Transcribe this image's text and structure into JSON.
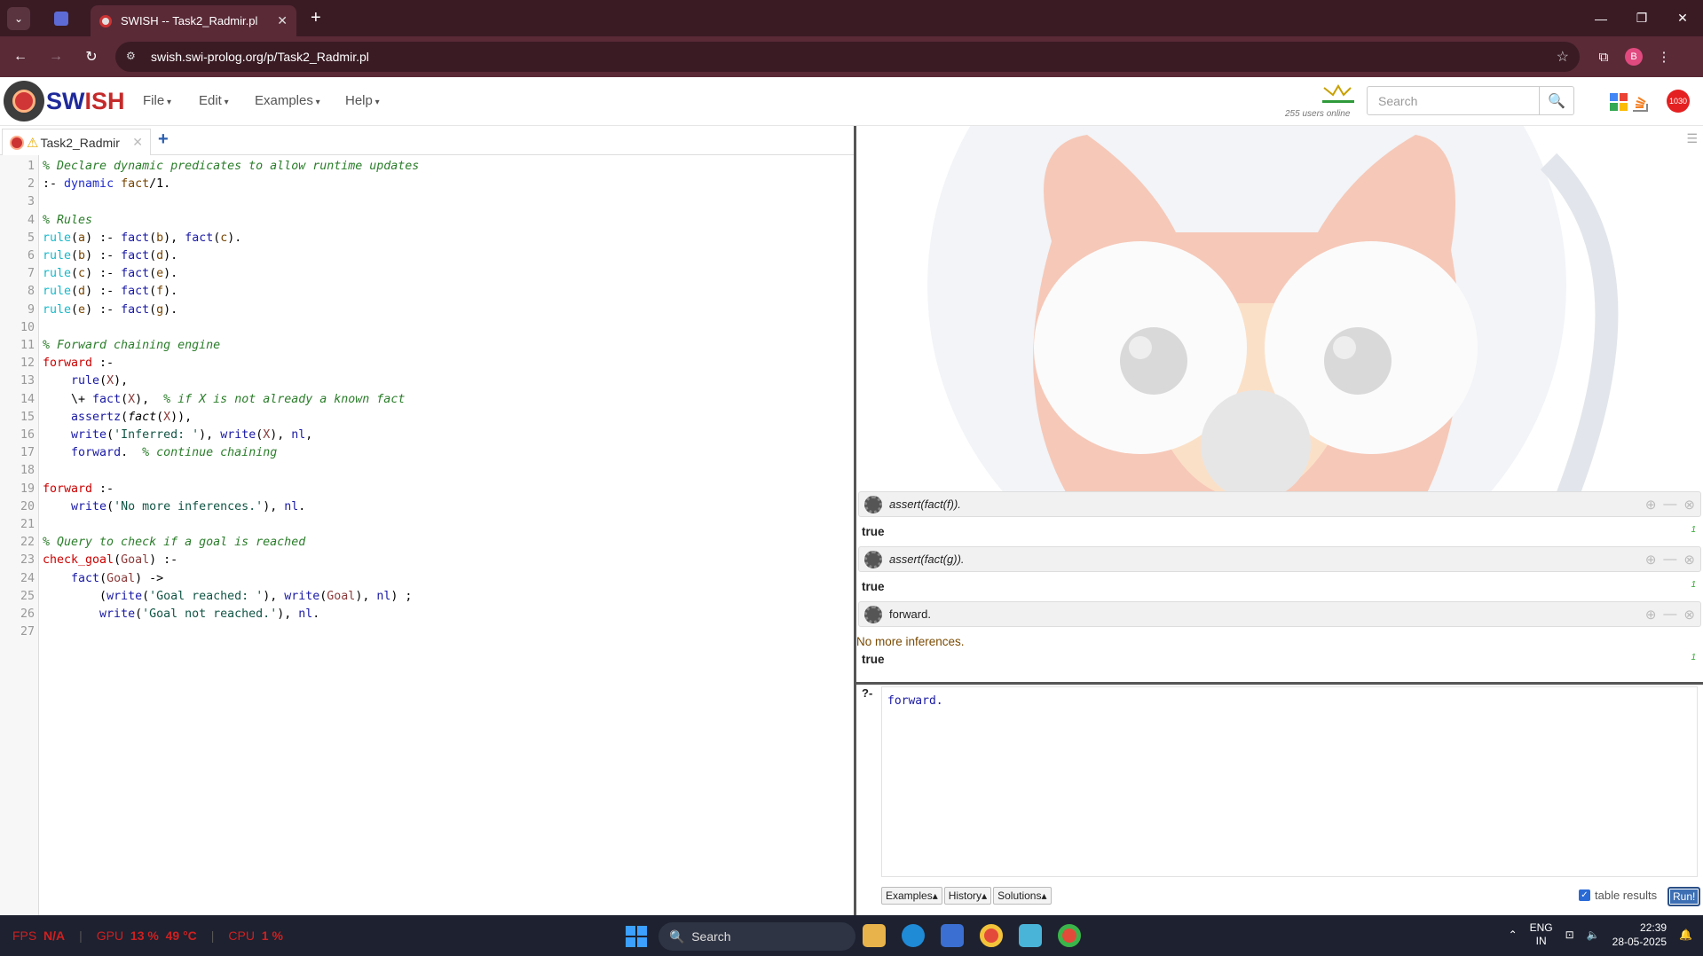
{
  "browser": {
    "tab_title": "SWISH -- Task2_Radmir.pl",
    "url": "swish.swi-prolog.org/p/Task2_Radmir.pl",
    "profile_initial": "B"
  },
  "swish": {
    "brand_prefix": "SW",
    "brand_suffix": "ISH",
    "menus": [
      "File",
      "Edit",
      "Examples",
      "Help"
    ],
    "users_online": "255 users online",
    "search_placeholder": "Search",
    "notif_count": "1030"
  },
  "editor": {
    "tab_label": "Task2_Radmir",
    "lines": [
      {
        "n": "1"
      },
      {
        "n": "2"
      },
      {
        "n": "3"
      },
      {
        "n": "4"
      },
      {
        "n": "5"
      },
      {
        "n": "6"
      },
      {
        "n": "7"
      },
      {
        "n": "8"
      },
      {
        "n": "9"
      },
      {
        "n": "10"
      },
      {
        "n": "11"
      },
      {
        "n": "12"
      },
      {
        "n": "13"
      },
      {
        "n": "14"
      },
      {
        "n": "15"
      },
      {
        "n": "16"
      },
      {
        "n": "17"
      },
      {
        "n": "18"
      },
      {
        "n": "19"
      },
      {
        "n": "20"
      },
      {
        "n": "21"
      },
      {
        "n": "22"
      },
      {
        "n": "23"
      },
      {
        "n": "24"
      },
      {
        "n": "25"
      },
      {
        "n": "26"
      },
      {
        "n": "27"
      }
    ],
    "code": {
      "l1": "% Declare dynamic predicates to allow runtime updates",
      "l2a": ":- ",
      "l2b": "dynamic",
      "l2c": " ",
      "l2d": "fact",
      "l2e": "/1.",
      "l4": "% Rules",
      "l11": "% Forward chaining engine",
      "l14c": "% if X is not already a known fact",
      "l17c": "% continue chaining",
      "l22": "% Query to check if a goal is reached",
      "l16s": "'Inferred: '",
      "l20s": "'No more inferences.'",
      "l25s": "'Goal reached: '",
      "l26s": "'Goal not reached.'"
    }
  },
  "results": {
    "queries": [
      {
        "text": "assert(fact(f)).",
        "answer": "true",
        "count": "1"
      },
      {
        "text": "assert(fact(g)).",
        "answer": "true",
        "count": "1"
      },
      {
        "text": "forward.",
        "output": "No more inferences.",
        "answer": "true",
        "count": "1"
      }
    ]
  },
  "query": {
    "prompt": "?-",
    "value": "forward.",
    "buttons": [
      "Examples",
      "History",
      "Solutions"
    ],
    "table_results": "table results",
    "run": "Run!"
  },
  "taskbar": {
    "fps_label": "FPS",
    "fps": "N/A",
    "gpu_label": "GPU",
    "gpu": "13 %",
    "gpu_temp": "49 °C",
    "cpu_label": "CPU",
    "cpu": "1 %",
    "search": "Search",
    "lang1": "ENG",
    "lang2": "IN",
    "time": "22:39",
    "date": "28-05-2025"
  }
}
